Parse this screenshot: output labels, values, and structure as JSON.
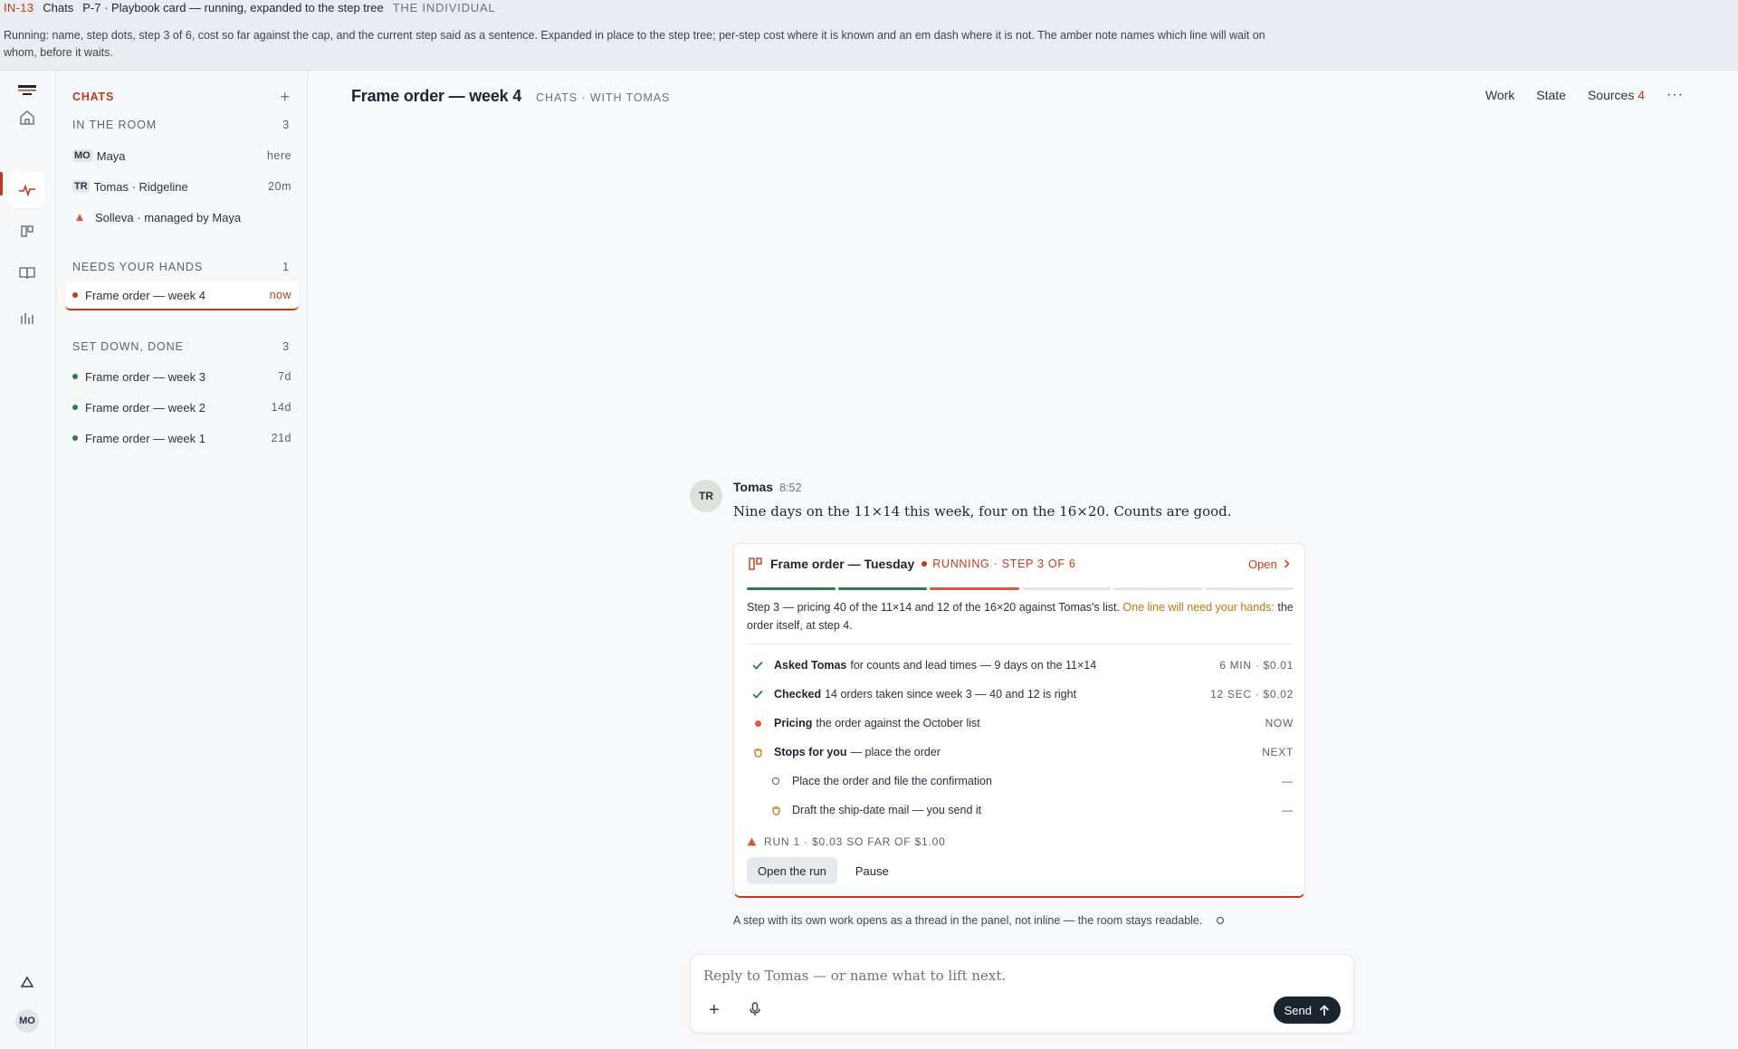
{
  "topbar": {
    "code": "IN-13",
    "section": "Chats",
    "title": "P-7 · Playbook card — running, expanded to the step tree",
    "category": "THE INDIVIDUAL",
    "description": "Running: name, step dots, step 3 of 6, cost so far against the cap, and the current step said as a sentence. Expanded in place to the step tree; per-step cost where it is known and an em dash where it is not. The amber note names which line will wait on whom, before it waits."
  },
  "rail": {
    "icons": [
      "logo-icon",
      "home-icon",
      "activity-icon",
      "board-icon",
      "book-icon",
      "chart-icon",
      "triangle-icon"
    ],
    "avatar": "MO"
  },
  "sidebar": {
    "header": "CHATS",
    "add": "+",
    "in_room": {
      "label": "IN THE ROOM",
      "count": "3",
      "people": [
        {
          "initials": "MO",
          "name": "Maya",
          "meta": "here"
        },
        {
          "initials": "TR",
          "name": "Tomas · Ridgeline",
          "meta": "20m"
        },
        {
          "initials": "",
          "name": "Solleva · managed by Maya",
          "meta": ""
        }
      ]
    },
    "needs": {
      "label": "NEEDS YOUR HANDS",
      "count": "1",
      "items": [
        {
          "name": "Frame order — week 4",
          "meta": "now"
        }
      ]
    },
    "done": {
      "label": "SET DOWN, DONE",
      "count": "3",
      "items": [
        {
          "name": "Frame order — week 3",
          "meta": "7d"
        },
        {
          "name": "Frame order — week 2",
          "meta": "14d"
        },
        {
          "name": "Frame order — week 1",
          "meta": "21d"
        }
      ]
    }
  },
  "main": {
    "title": "Frame order — week 4",
    "subtitle": "CHATS · WITH TOMAS",
    "nav": {
      "work": "Work",
      "state": "State",
      "sources": "Sources",
      "sources_count": "4",
      "more": "···"
    }
  },
  "message": {
    "avatar": "TR",
    "author": "Tomas",
    "time": "8:52",
    "body": "Nine days on the 11×14 this week, four on the 16×20. Counts are good."
  },
  "card": {
    "title": "Frame order — Tuesday",
    "status": "RUNNING · STEP 3 OF 6",
    "open": "Open",
    "progress": {
      "total": 6,
      "done": 2,
      "current": 3
    },
    "sentence": "Step 3 — pricing 40 of the 11×14 and 12 of the 16×20 against Tomas's list.",
    "sentence_amber": "One line will need your hands:",
    "sentence_tail": "the order itself, at step 4.",
    "steps": [
      {
        "state": "done",
        "name": "Asked Tomas",
        "text": "for counts and lead times — 9 days on the 11×14",
        "meta": "6 MIN · $0.01"
      },
      {
        "state": "done",
        "name": "Checked",
        "text": "14 orders taken since week 3 — 40 and 12 is right",
        "meta": "12 SEC · $0.02"
      },
      {
        "state": "now",
        "name": "Pricing",
        "text": "the order against the October list",
        "meta": "NOW"
      },
      {
        "state": "hand",
        "name": "Stops for you",
        "text": "— place the order",
        "meta": "NEXT"
      },
      {
        "state": "sub-pending",
        "name": "",
        "text": "Place the order and file the confirmation",
        "meta": "—"
      },
      {
        "state": "sub-hand",
        "name": "",
        "text": "Draft the ship-date mail — you send it",
        "meta": "—"
      }
    ],
    "run": "RUN 1 · $0.03 SO FAR OF $1.00",
    "open_run": "Open the run",
    "pause": "Pause"
  },
  "note": "A step with its own work opens as a thread in the panel, not inline — the room stays readable.",
  "composer": {
    "placeholder": "Reply to Tomas — or name what to lift next.",
    "send": "Send"
  },
  "colors": {
    "accent": "#c0391b",
    "done": "#2f7a4a",
    "amber": "#b8790c",
    "dark": "#1b2530"
  }
}
